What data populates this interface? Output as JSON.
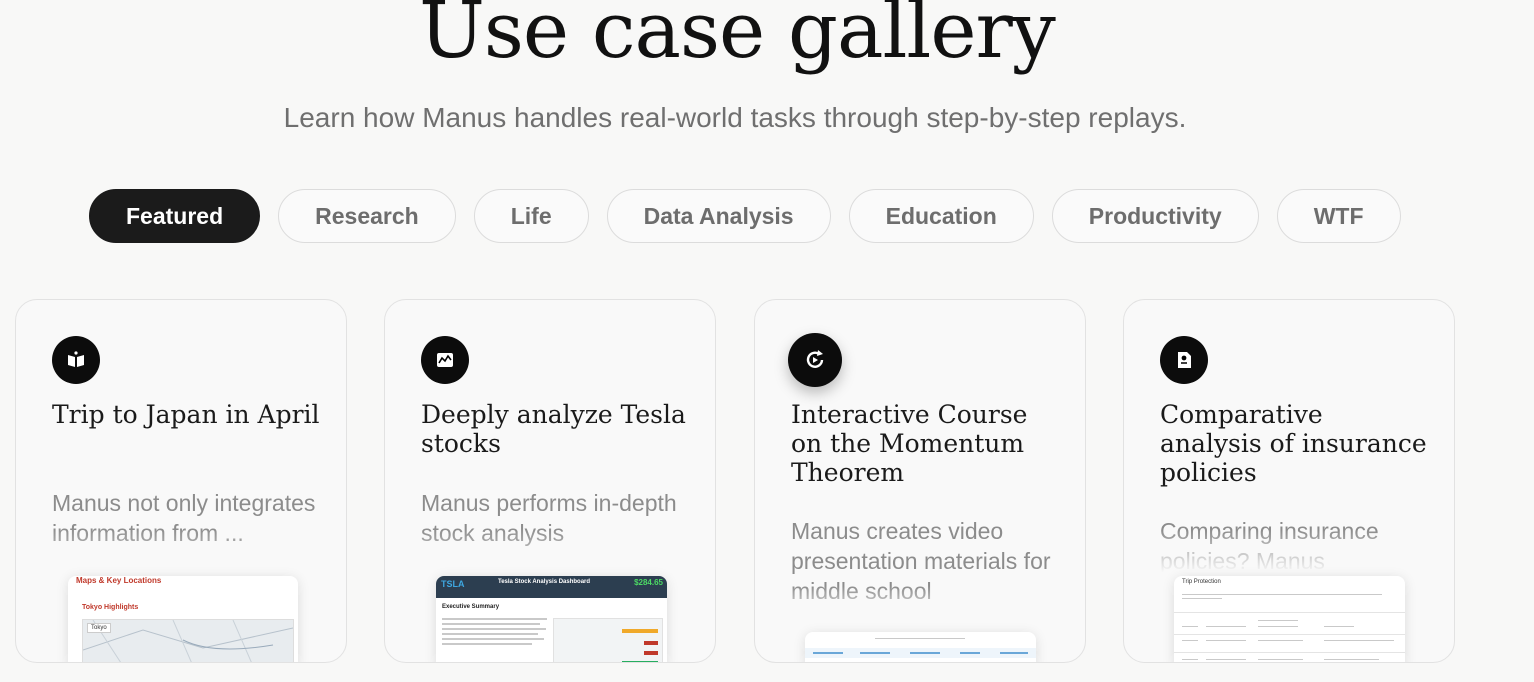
{
  "header": {
    "title": "Use case gallery",
    "subtitle": "Learn how Manus handles real-world tasks through step-by-step replays."
  },
  "tabs": [
    {
      "label": "Featured",
      "active": true
    },
    {
      "label": "Research",
      "active": false
    },
    {
      "label": "Life",
      "active": false
    },
    {
      "label": "Data Analysis",
      "active": false
    },
    {
      "label": "Education",
      "active": false
    },
    {
      "label": "Productivity",
      "active": false
    },
    {
      "label": "WTF",
      "active": false
    }
  ],
  "cards": [
    {
      "icon": "book-icon",
      "title": "Trip to Japan in April",
      "description": "Manus not only integrates information from ...",
      "preview": {
        "heading": "Maps & Key Locations",
        "subheading": "Tokyo Highlights",
        "place": "Tokyo"
      }
    },
    {
      "icon": "chart-icon",
      "title": "Deeply analyze Tesla stocks",
      "description": "Manus performs in-depth stock analysis",
      "preview": {
        "ticker": "TSLA",
        "title": "Tesla Stock Analysis Dashboard",
        "price": "$284.65",
        "section": "Executive Summary"
      }
    },
    {
      "icon": "replay-icon",
      "title": "Interactive Course on the Momentum Theorem",
      "description": "Manus creates video presentation materials for middle school"
    },
    {
      "icon": "document-icon",
      "title": "Comparative analysis of insurance policies",
      "description": "Comparing insurance policies? Manus",
      "preview": {
        "heading": "Trip Protection"
      }
    }
  ],
  "colors": {
    "background": "#f8f8f7",
    "active_tab": "#1b1b1b",
    "accent_red": "#c0392b",
    "dashboard_header": "#2c3e50"
  }
}
